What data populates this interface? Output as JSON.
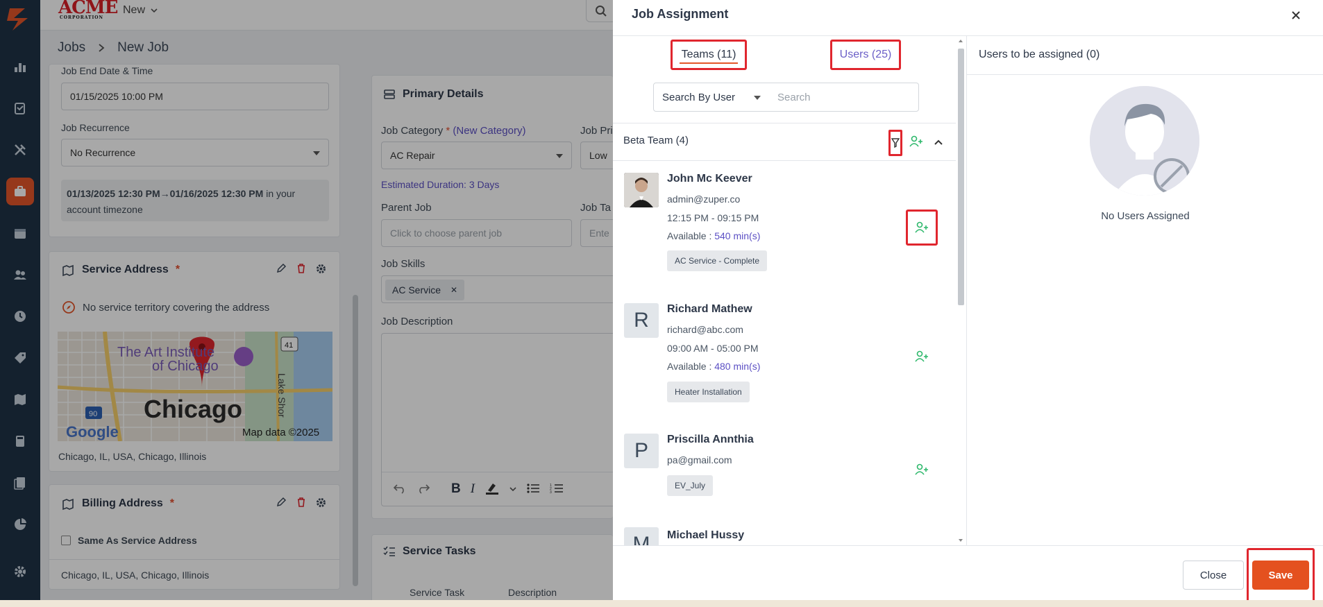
{
  "brand": {
    "name": "ACME",
    "sub": "CORPORATION"
  },
  "topbar": {
    "new_label": "New"
  },
  "breadcrumb": {
    "root": "Jobs",
    "current": "New Job"
  },
  "left": {
    "end_label": "Job End Date & Time",
    "end_value": "01/15/2025 10:00 PM",
    "recurrence_label": "Job Recurrence",
    "recurrence_value": "No Recurrence",
    "range_text": "01/13/2025 12:30 PM→01/16/2025 12:30 PM",
    "range_suffix": " in your",
    "range_tz": "account timezone",
    "service_title": "Service Address",
    "territory_note": "No service territory covering the address",
    "service_address": "Chicago, IL, USA, Chicago, Illinois",
    "billing_title": "Billing Address",
    "same_as_service": "Same As Service Address",
    "billing_address": "Chicago, IL, USA, Chicago, Illinois",
    "map": {
      "place1": "The Art Institute",
      "place2": "of Chicago",
      "city": "Chicago",
      "lake": "Lake Shor",
      "route1": "41",
      "route2": "90",
      "google": "Google",
      "copyright": "Map data ©2025"
    }
  },
  "middle": {
    "primary_title": "Primary Details",
    "category_label": "Job Category",
    "new_category": "(New Category)",
    "category_value": "AC Repair",
    "priority_label": "Job Pri",
    "priority_value": "Low",
    "estimated": "Estimated Duration: 3 Days",
    "parent_label": "Parent Job",
    "parent_placeholder": "Click to choose parent job",
    "tags_label": "Job Ta",
    "tags_placeholder": "Ente",
    "skills_label": "Job Skills",
    "skill_chip": "AC Service",
    "description_label": "Job Description",
    "tasks_title": "Service Tasks",
    "tasks_col1": "Service Task",
    "tasks_col2": "Description"
  },
  "modal": {
    "title": "Job Assignment",
    "tab_teams": "Teams (11)",
    "tab_users": "Users (25)",
    "search_by": "Search By User",
    "search_placeholder": "Search",
    "team_name": "Beta Team (4)",
    "users": [
      {
        "name": "John Mc Keever",
        "email": "admin@zuper.co",
        "hours": "12:15 PM - 09:15 PM",
        "avail_label": "Available : ",
        "avail_mins": "540 min(s)",
        "skill": "AC Service - Complete"
      },
      {
        "name": "Richard Mathew",
        "initial": "R",
        "email": "richard@abc.com",
        "hours": "09:00 AM - 05:00 PM",
        "avail_label": "Available : ",
        "avail_mins": "480 min(s)",
        "skill": "Heater Installation"
      },
      {
        "name": "Priscilla Annthia",
        "initial": "P",
        "email": "pa@gmail.com",
        "skill": "EV_July"
      },
      {
        "name": "Michael Hussy",
        "initial": "M"
      }
    ],
    "assigned_title": "Users to be assigned (0)",
    "empty_text": "No Users Assigned",
    "close_label": "Close",
    "save_label": "Save"
  },
  "colors": {
    "accent": "#e4511f",
    "nav": "#1f3246",
    "link": "#5b4fc4",
    "add_green": "#2db86b",
    "highlight": "#e0262e"
  }
}
